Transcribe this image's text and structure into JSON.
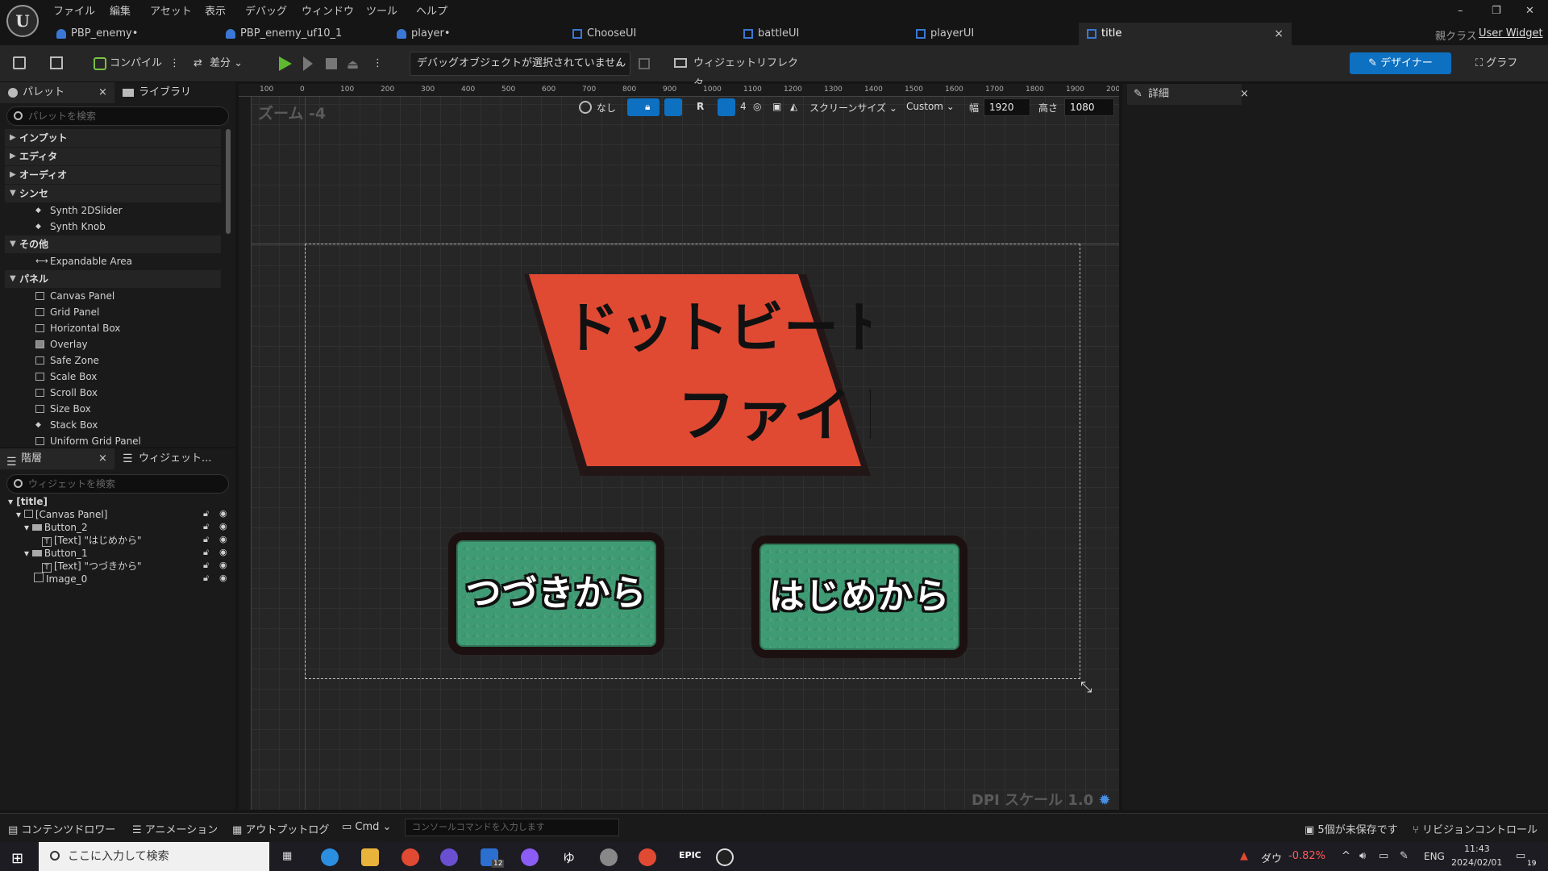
{
  "menubar": {
    "items": [
      "ファイル",
      "編集",
      "アセット",
      "表示",
      "デバッグ",
      "ウィンドウ",
      "ツール",
      "ヘルプ"
    ],
    "window_controls": [
      "–",
      "❐",
      "✕"
    ]
  },
  "tabs": [
    {
      "label": "PBP_enemy•"
    },
    {
      "label": "PBP_enemy_uf10_1"
    },
    {
      "label": "player•"
    },
    {
      "label": "ChooseUI"
    },
    {
      "label": "battleUI"
    },
    {
      "label": "playerUI"
    },
    {
      "label": "title",
      "active": true
    }
  ],
  "parent_class": {
    "label": "親クラス",
    "value": "User Widget"
  },
  "toolbar": {
    "compile": "コンパイル",
    "diff": "差分",
    "debug_object": "デバッグオブジェクトが選択されていません",
    "widget_reflector": "ウィジェットリフレクタ",
    "designer": "デザイナー",
    "graph": "グラフ"
  },
  "palette": {
    "tab": "パレット",
    "library_tab": "ライブラリ",
    "search_placeholder": "パレットを検索",
    "categories": [
      {
        "label": "インプット",
        "expanded": false
      },
      {
        "label": "エディタ",
        "expanded": false
      },
      {
        "label": "オーディオ",
        "expanded": false
      },
      {
        "label": "シンセ",
        "expanded": true,
        "items": [
          "Synth 2DSlider",
          "Synth Knob"
        ]
      },
      {
        "label": "その他",
        "expanded": true,
        "items": [
          "Expandable Area"
        ]
      },
      {
        "label": "パネル",
        "expanded": true,
        "items": [
          "Canvas Panel",
          "Grid Panel",
          "Horizontal Box",
          "Overlay",
          "Safe Zone",
          "Scale Box",
          "Scroll Box",
          "Size Box",
          "Stack Box",
          "Uniform Grid Panel"
        ]
      }
    ]
  },
  "hierarchy": {
    "tab": "階層",
    "widget_tab": "ウィジェット...",
    "search_placeholder": "ウィジェットを検索",
    "items": [
      {
        "label": "[title]",
        "depth": 0
      },
      {
        "label": "[Canvas Panel]",
        "depth": 1
      },
      {
        "label": "Button_2",
        "depth": 2
      },
      {
        "label": "[Text] \"はじめから\"",
        "depth": 3
      },
      {
        "label": "Button_1",
        "depth": 2
      },
      {
        "label": "[Text] \"つづきから\"",
        "depth": 3
      },
      {
        "label": "Image_0",
        "depth": 2
      }
    ]
  },
  "designer": {
    "zoom": "ズーム -4",
    "dpi": "DPI スケール 1.0",
    "ruler_top": [
      "100",
      "0",
      "100",
      "200",
      "300",
      "400",
      "500",
      "600",
      "700",
      "800",
      "900",
      "1000",
      "1100",
      "1200",
      "1300",
      "1400",
      "1500",
      "1600",
      "1700",
      "1800",
      "1900",
      "2000"
    ],
    "view": {
      "localize": "なし",
      "r": "R",
      "grid": "4",
      "screen_size": "スクリーンサイズ",
      "preset": "Custom",
      "width_label": "幅",
      "width": "1920",
      "height_label": "高さ",
      "height": "1080"
    },
    "title_line1": "ドットビート",
    "title_line2": "ファイト",
    "button_continue": "つづきから",
    "button_start": "はじめから"
  },
  "details": {
    "tab": "詳細"
  },
  "bottombar": {
    "content_drawer": "コンテンツドロワー",
    "animation": "アニメーション",
    "output_log": "アウトプットログ",
    "cmd": "Cmd",
    "console_placeholder": "コンソールコマンドを入力します",
    "unsaved": "5個が未保存です",
    "revision": "リビジョンコントロール"
  },
  "taskbar": {
    "search_placeholder": "ここに入力して検索",
    "stock_name": "ダウ",
    "stock_change": "-0.82%",
    "lang": "ENG",
    "time": "11:43",
    "date": "2024/02/01",
    "mail_badge": "12",
    "notif_badge": "19"
  },
  "colors": {
    "accent": "#0e70c0",
    "title_fill": "#e04a33",
    "button_fill": "#3f9b74",
    "stock_down": "#ff5a5a"
  }
}
